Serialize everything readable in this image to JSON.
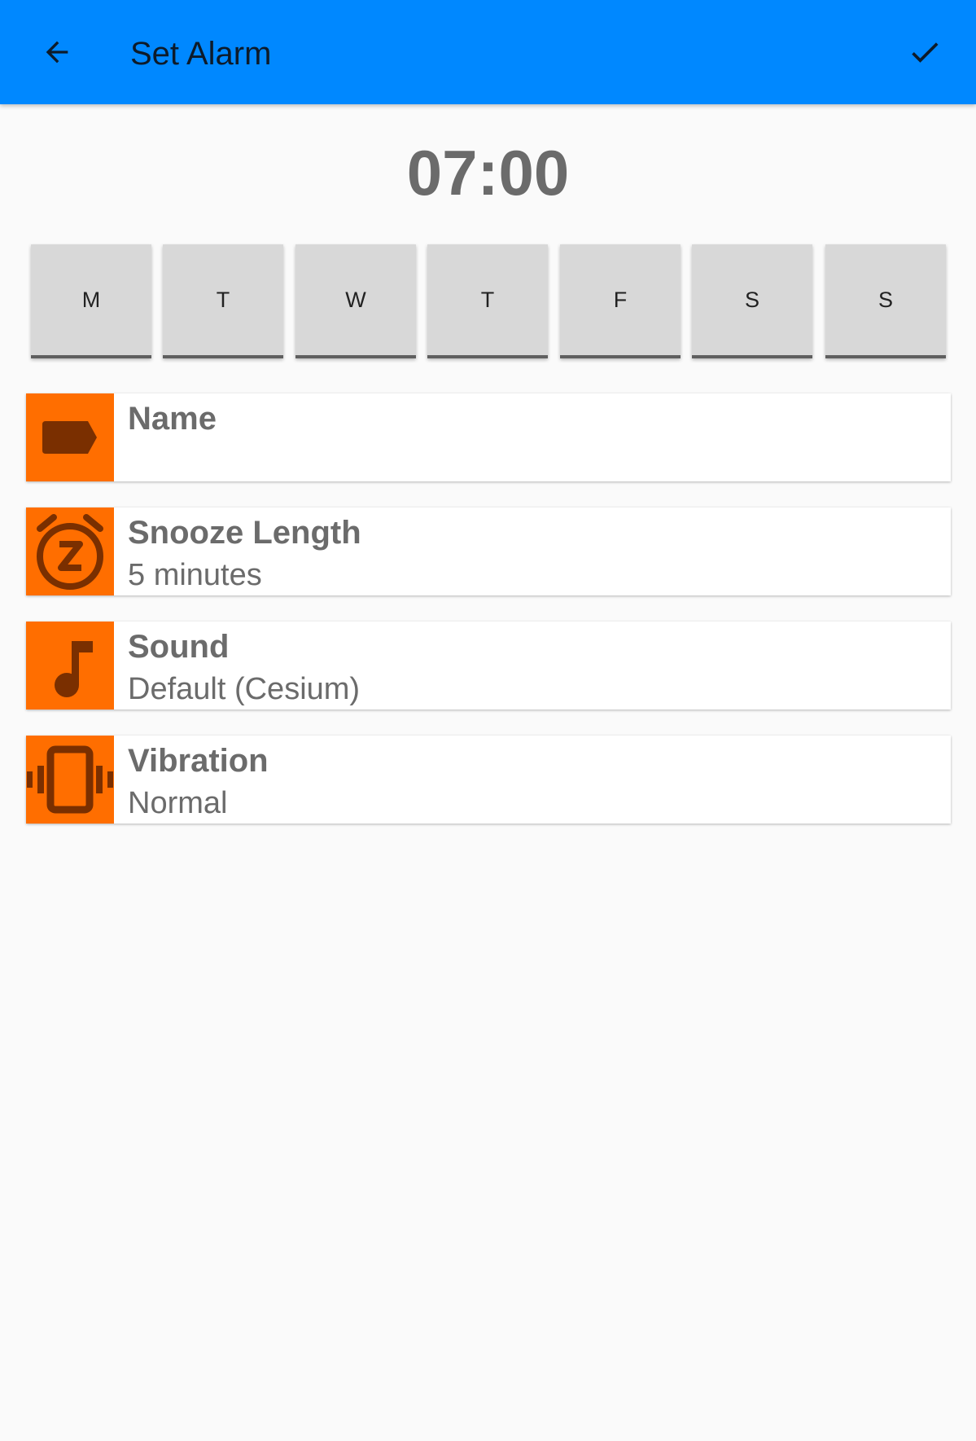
{
  "header": {
    "title": "Set Alarm",
    "back_icon": "arrow-back-icon",
    "confirm_icon": "check-icon",
    "background_color": "#0088ff"
  },
  "alarm": {
    "time": "07:00"
  },
  "days": [
    {
      "label": "M"
    },
    {
      "label": "T"
    },
    {
      "label": "W"
    },
    {
      "label": "T"
    },
    {
      "label": "F"
    },
    {
      "label": "S"
    },
    {
      "label": "S"
    }
  ],
  "settings": [
    {
      "label": "Name",
      "value": "",
      "icon": "label-tag-icon"
    },
    {
      "label": "Snooze Length",
      "value": "5 minutes",
      "icon": "snooze-alarm-icon"
    },
    {
      "label": "Sound",
      "value": "Default (Cesium)",
      "icon": "music-note-icon"
    },
    {
      "label": "Vibration",
      "value": "Normal",
      "icon": "vibration-icon"
    }
  ],
  "colors": {
    "accent": "#ff6e00",
    "icon_fill": "#7a2f00",
    "text_secondary": "#6b6b6b"
  }
}
